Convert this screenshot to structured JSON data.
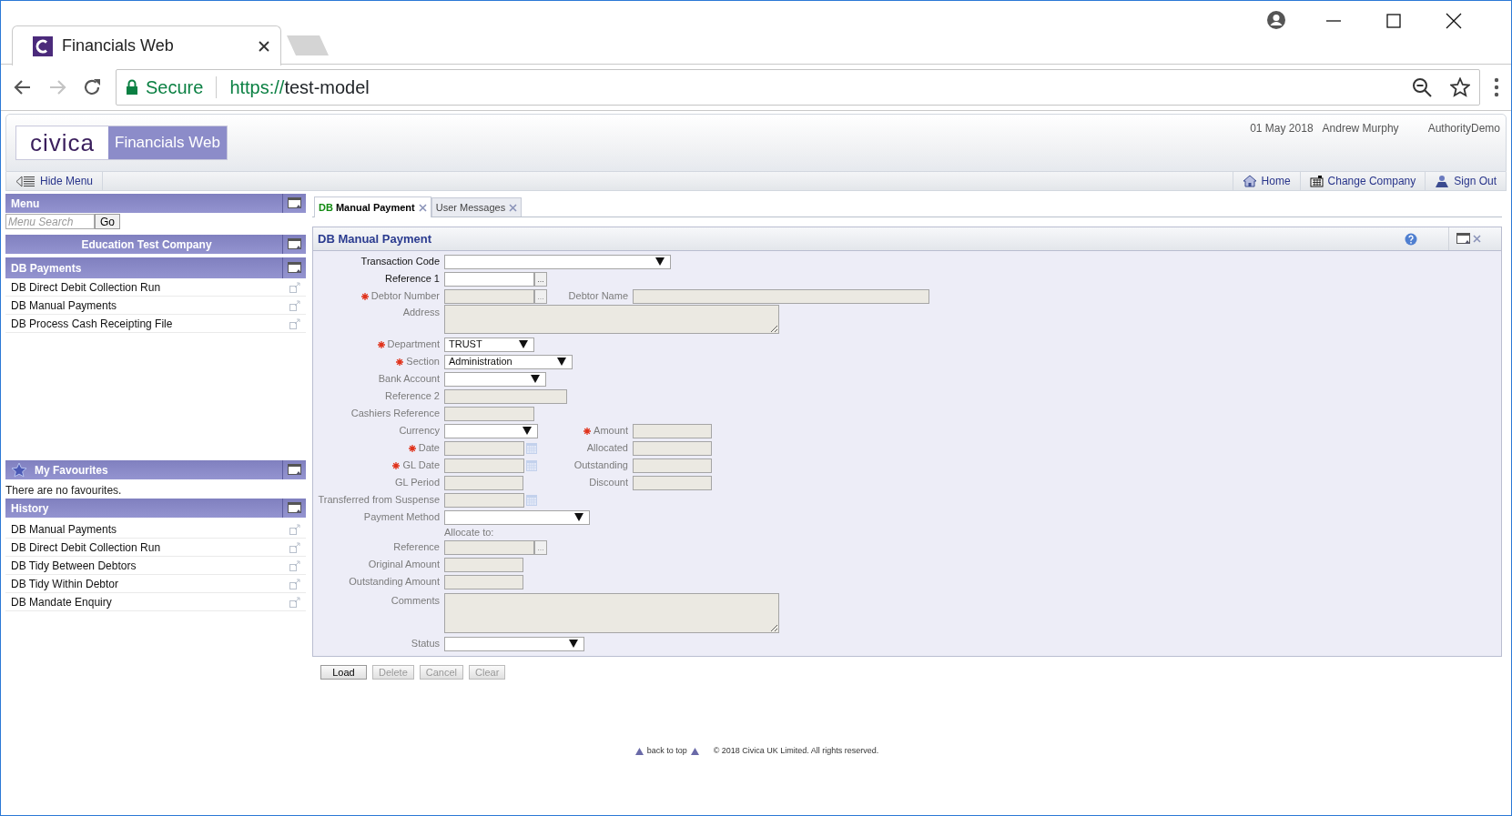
{
  "browser": {
    "tab_title": "Financials Web",
    "secure_label": "Secure",
    "url_scheme": "https://",
    "url_host": "test-model",
    "forward_disabled": true
  },
  "app": {
    "logo": "civica",
    "product": "Financials Web",
    "date": "01 May 2018",
    "user": "Andrew Murphy",
    "authority": "AuthorityDemo"
  },
  "toolbar": {
    "hide_menu": "Hide Menu",
    "links": [
      {
        "kind": "home",
        "label": "Home"
      },
      {
        "kind": "company",
        "label": "Change Company"
      },
      {
        "kind": "signout",
        "label": "Sign Out"
      }
    ]
  },
  "sidebar": {
    "menu": {
      "title": "Menu",
      "search_placeholder": "Menu Search",
      "go": "Go"
    },
    "company": "Education Test Company",
    "section": {
      "title": "DB Payments",
      "items": [
        "DB Direct Debit Collection Run",
        "DB Manual Payments",
        "DB Process Cash Receipting File"
      ]
    },
    "favourites": {
      "title": "My Favourites",
      "empty": "There are no favourites."
    },
    "history": {
      "title": "History",
      "items": [
        "DB Manual Payments",
        "DB Direct Debit Collection Run",
        "DB Tidy Between Debtors",
        "DB Tidy Within Debtor",
        "DB Mandate Enquiry"
      ]
    }
  },
  "tabs": [
    {
      "prefix": "DB",
      "label": "Manual Payment",
      "selected": true
    },
    {
      "label": "User Messages",
      "selected": false
    }
  ],
  "panel": {
    "title": "DB Manual Payment",
    "rows": [
      {
        "fields": [
          {
            "label": "Transaction Code",
            "kind": "select",
            "active": true,
            "required": false,
            "disabled": false
          }
        ]
      },
      {
        "fields": [
          {
            "label": "Reference 1",
            "kind": "lookup",
            "button": "...",
            "active": true,
            "required": false,
            "disabled": false
          }
        ]
      },
      {
        "fields": [
          {
            "label": "Debtor Number",
            "kind": "lookup",
            "button": "...",
            "active": false,
            "required": true,
            "disabled": true
          },
          {
            "label": "Debtor Name",
            "kind": "text",
            "active": false,
            "required": false,
            "disabled": true
          }
        ]
      },
      {
        "fields": [
          {
            "label": "Address",
            "kind": "textarea",
            "active": false,
            "required": false,
            "disabled": true
          }
        ]
      },
      {
        "fields": [
          {
            "label": "Department",
            "kind": "select",
            "value": "TRUST",
            "active": false,
            "required": true,
            "disabled": false
          }
        ]
      },
      {
        "fields": [
          {
            "label": "Section",
            "kind": "select",
            "value": "Administration",
            "active": false,
            "required": true,
            "disabled": false
          }
        ]
      },
      {
        "fields": [
          {
            "label": "Bank Account",
            "kind": "select",
            "active": false,
            "required": false,
            "disabled": false
          }
        ]
      },
      {
        "fields": [
          {
            "label": "Reference 2",
            "kind": "text",
            "active": false,
            "required": false,
            "disabled": true
          }
        ]
      },
      {
        "fields": [
          {
            "label": "Cashiers Reference",
            "kind": "text",
            "active": false,
            "required": false,
            "disabled": true
          }
        ]
      },
      {
        "fields": [
          {
            "label": "Currency",
            "kind": "select",
            "active": false,
            "required": false,
            "disabled": false
          },
          {
            "label": "Amount",
            "kind": "text",
            "active": false,
            "required": true,
            "disabled": true
          }
        ]
      },
      {
        "fields": [
          {
            "label": "Date",
            "kind": "date",
            "active": false,
            "required": true,
            "disabled": true
          },
          {
            "label": "Allocated",
            "kind": "text",
            "active": false,
            "required": false,
            "disabled": true
          }
        ]
      },
      {
        "fields": [
          {
            "label": "GL Date",
            "kind": "date",
            "active": false,
            "required": true,
            "disabled": true
          },
          {
            "label": "Outstanding",
            "kind": "text",
            "active": false,
            "required": false,
            "disabled": true
          }
        ]
      },
      {
        "fields": [
          {
            "label": "GL Period",
            "kind": "text",
            "active": false,
            "required": false,
            "disabled": true
          },
          {
            "label": "Discount",
            "kind": "text",
            "active": false,
            "required": false,
            "disabled": true
          }
        ]
      },
      {
        "fields": [
          {
            "label": "Transferred from Suspense",
            "kind": "date",
            "active": false,
            "required": false,
            "disabled": true
          }
        ]
      },
      {
        "fields": [
          {
            "label": "Payment Method",
            "kind": "select",
            "active": false,
            "required": false,
            "disabled": false
          }
        ]
      },
      {
        "note": "Allocate to:"
      },
      {
        "fields": [
          {
            "label": "Reference",
            "kind": "lookup",
            "button": "...",
            "active": false,
            "required": false,
            "disabled": true
          }
        ]
      },
      {
        "fields": [
          {
            "label": "Original Amount",
            "kind": "text",
            "active": false,
            "required": false,
            "disabled": true
          }
        ]
      },
      {
        "fields": [
          {
            "label": "Outstanding Amount",
            "kind": "text",
            "active": false,
            "required": false,
            "disabled": true
          }
        ]
      },
      {
        "fields": [
          {
            "label": "Comments",
            "kind": "textarea",
            "active": false,
            "required": false,
            "disabled": true
          }
        ]
      },
      {
        "fields": [
          {
            "label": "Status",
            "kind": "select",
            "active": false,
            "required": false,
            "disabled": false
          }
        ]
      }
    ]
  },
  "buttons": [
    {
      "label": "Load",
      "disabled": false
    },
    {
      "label": "Delete",
      "disabled": true
    },
    {
      "label": "Cancel",
      "disabled": true
    },
    {
      "label": "Clear",
      "disabled": true
    }
  ],
  "footer": {
    "back_to_top": "back to top",
    "copyright": "© 2018 Civica UK Limited. All rights reserved."
  }
}
